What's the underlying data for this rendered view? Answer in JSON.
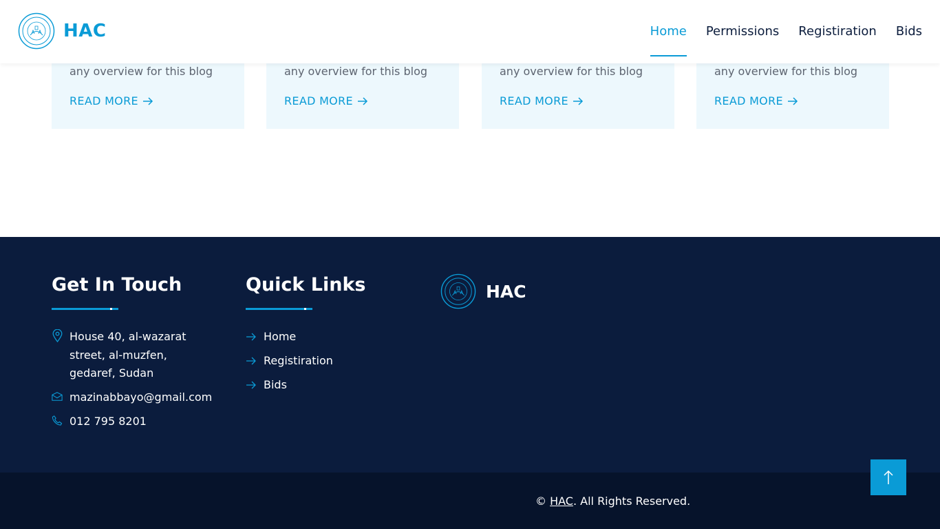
{
  "header": {
    "brand": "HAC",
    "nav": [
      {
        "label": "Home",
        "active": true
      },
      {
        "label": "Permissions",
        "active": false
      },
      {
        "label": "Registiration",
        "active": false
      },
      {
        "label": "Bids",
        "active": false
      }
    ]
  },
  "blog_cards": [
    {
      "overview": "any overview for this blog",
      "read_more": "READ MORE"
    },
    {
      "overview": "any overview for this blog",
      "read_more": "READ MORE"
    },
    {
      "overview": "any overview for this blog",
      "read_more": "READ MORE"
    },
    {
      "overview": "any overview for this blog",
      "read_more": "READ MORE"
    }
  ],
  "footer": {
    "get_in_touch": {
      "title": "Get In Touch",
      "address": "House 40, al-wazarat street, al-muzfen, gedaref, Sudan",
      "email": "mazinabbayo@gmail.com",
      "phone": "012 795 8201"
    },
    "quick_links": {
      "title": "Quick Links",
      "links": [
        "Home",
        "Registiration",
        "Bids"
      ]
    },
    "brand": "HAC",
    "copyright_prefix": "©",
    "copyright_link": "HAC",
    "copyright_suffix": ". All Rights Reserved."
  },
  "colors": {
    "accent": "#0a9bd6",
    "footer_bg": "#0b1c3d",
    "copyright_bg": "#06132b",
    "card_bg": "#edf8fd"
  }
}
